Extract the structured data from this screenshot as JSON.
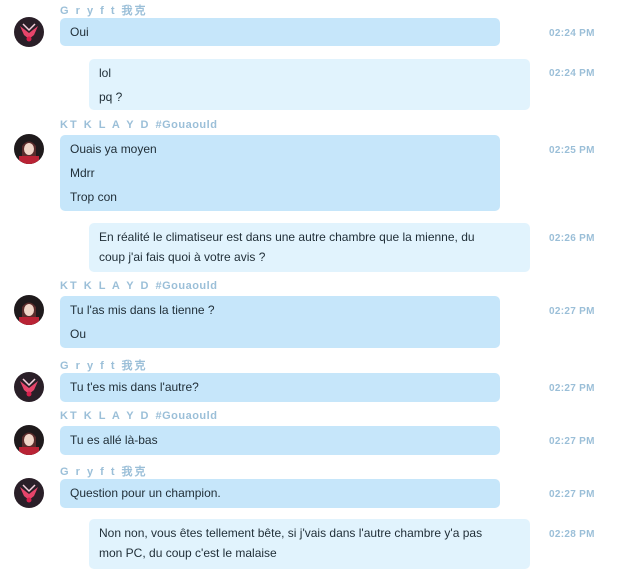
{
  "users": {
    "gryft": "G r y f t 我克",
    "klayd_name": "KT  K L A Y D",
    "klayd_tag": "#Gouaould"
  },
  "messages": [
    {
      "lines": [
        "Oui"
      ],
      "time": "02:24 PM"
    },
    {
      "lines": [
        "lol",
        "pq ?"
      ],
      "time": "02:24 PM"
    },
    {
      "lines": [
        "Ouais ya moyen",
        "Mdrr",
        "Trop con"
      ],
      "time": "02:25 PM"
    },
    {
      "lines": [
        "En réalité le climatiseur est dans une autre chambre que la mienne, du",
        "coup j'ai fais quoi à votre avis ?"
      ],
      "time": "02:26 PM"
    },
    {
      "lines": [
        "Tu l'as mis dans la tienne ?",
        "Ou"
      ],
      "time": "02:27 PM"
    },
    {
      "lines": [
        "Tu t'es mis dans l'autre?"
      ],
      "time": "02:27 PM"
    },
    {
      "lines": [
        "Tu es allé là-bas"
      ],
      "time": "02:27 PM"
    },
    {
      "lines": [
        "Question pour un champion."
      ],
      "time": "02:27 PM"
    },
    {
      "lines": [
        "Non non, vous êtes tellement bête, si j'vais dans l'autre chambre y'a pas",
        "mon PC, du coup c'est le malaise"
      ],
      "time": "02:28 PM"
    }
  ],
  "colors": {
    "own_bubble": "#c6e6fa",
    "other_bubble": "#e1f3fd",
    "meta_text": "#9bbfd8"
  }
}
